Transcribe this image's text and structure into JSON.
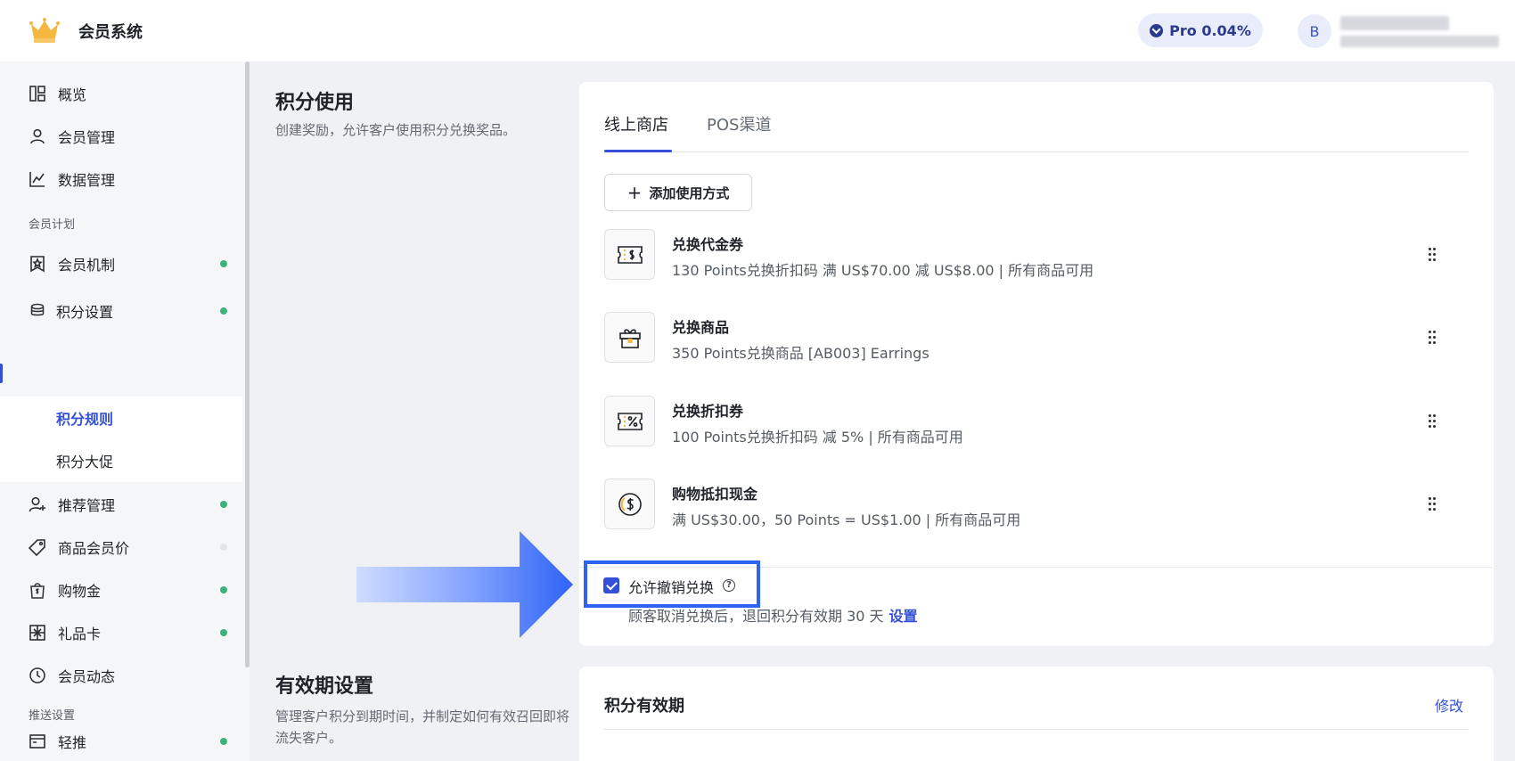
{
  "header": {
    "app_title": "会员系统",
    "logo_icon": "crown-icon",
    "plan_label": "Pro 0.04%",
    "avatar_letter": "B"
  },
  "sidebar": {
    "items_top": [
      {
        "label": "概览",
        "icon": "dashboard-icon"
      },
      {
        "label": "会员管理",
        "icon": "user-icon"
      },
      {
        "label": "数据管理",
        "icon": "line-chart-icon"
      }
    ],
    "section_program": "会员计划",
    "program_items": [
      {
        "label": "会员机制",
        "icon": "member-badge-icon",
        "status": "on"
      },
      {
        "label": "积分设置",
        "icon": "coins-icon",
        "status": "on"
      }
    ],
    "points_sub": [
      {
        "label": "积分规则",
        "active": true
      },
      {
        "label": "积分大促",
        "active": false
      }
    ],
    "program_items_2": [
      {
        "label": "推荐管理",
        "icon": "user-plus-icon",
        "status": "on"
      },
      {
        "label": "商品会员价",
        "icon": "tag-icon",
        "status": "off"
      },
      {
        "label": "购物金",
        "icon": "shopping-bag-icon",
        "status": "on"
      },
      {
        "label": "礼品卡",
        "icon": "gift-card-icon",
        "status": "on"
      },
      {
        "label": "会员动态",
        "icon": "clock-icon",
        "status": "none"
      }
    ],
    "section_push": "推送设置",
    "push_items": [
      {
        "label": "轻推",
        "icon": "window-icon",
        "status": "on"
      }
    ]
  },
  "points_usage": {
    "title": "积分使用",
    "description": "创建奖励，允许客户使用积分兑换奖品。",
    "tabs": [
      {
        "label": "线上商店",
        "active": true
      },
      {
        "label": "POS渠道",
        "active": false
      }
    ],
    "add_button": "添加使用方式",
    "rewards": [
      {
        "name": "兑换代金券",
        "detail": "130 Points兑换折扣码 满 US$70.00 减 US$8.00 | 所有商品可用",
        "icon": "voucher-dollar-icon"
      },
      {
        "name": "兑换商品",
        "detail": "350 Points兑换商品 [AB003] Earrings",
        "icon": "gift-box-icon"
      },
      {
        "name": "兑换折扣券",
        "detail": "100 Points兑换折扣码 减 5% | 所有商品可用",
        "icon": "voucher-percent-icon"
      },
      {
        "name": "购物抵扣现金",
        "detail": "满 US$30.00，50 Points = US$1.00 | 所有商品可用",
        "icon": "dollar-coin-icon"
      }
    ],
    "allow_refund": {
      "label": "允许撤销兑换",
      "checked": true,
      "note": "顾客取消兑换后，退回积分有效期 30 天",
      "link": "设置"
    }
  },
  "expiry": {
    "title": "有效期设置",
    "description": "管理客户积分到期时间，并制定如何有效召回即将流失客户。",
    "card_title": "积分有效期",
    "edit_link": "修改"
  },
  "colors": {
    "accent": "#3450d8",
    "highlight": "#2f63f5",
    "status_on": "#3cb37a"
  }
}
